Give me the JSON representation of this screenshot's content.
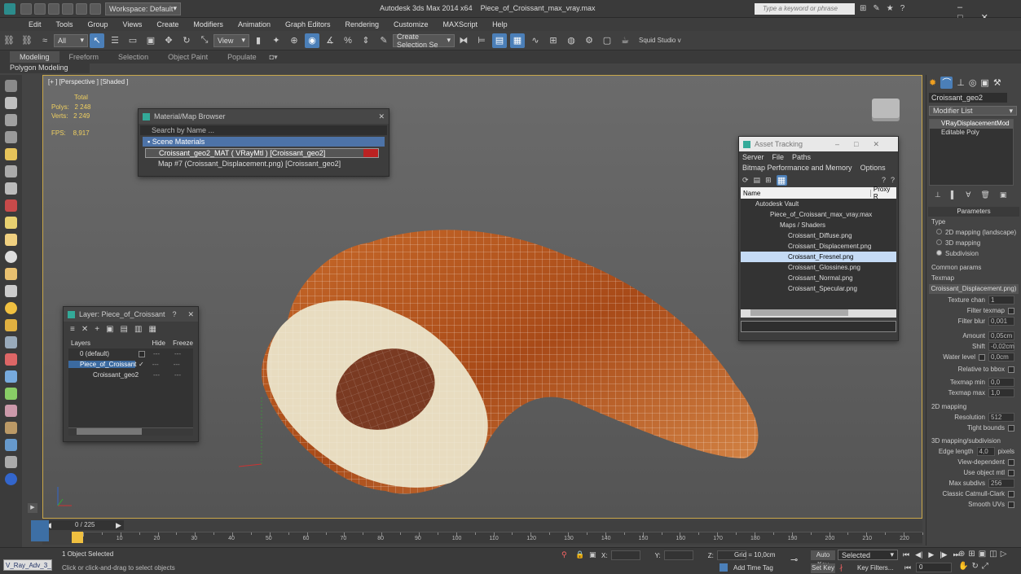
{
  "title": {
    "app": "Autodesk 3ds Max  2014 x64",
    "file": "Piece_of_Croissant_max_vray.max",
    "workspace": "Workspace: Default",
    "search_placeholder": "Type a keyword or phrase"
  },
  "menu": [
    "Edit",
    "Tools",
    "Group",
    "Views",
    "Create",
    "Modifiers",
    "Animation",
    "Graph Editors",
    "Rendering",
    "Customize",
    "MAXScript",
    "Help"
  ],
  "toolbar": {
    "filter": "All",
    "refcoord": "View",
    "selection_set": "Create Selection Se",
    "studio": "Squid Studio v"
  },
  "ribbon": {
    "tabs": [
      "Modeling",
      "Freeform",
      "Selection",
      "Object Paint",
      "Populate"
    ],
    "sub": "Polygon Modeling"
  },
  "viewport": {
    "label": "[+ ] [Perspective ] [Shaded ]",
    "stats_header": "Total",
    "polys_label": "Polys:",
    "polys": "2 248",
    "verts_label": "Verts:",
    "verts": "2 249",
    "fps_label": "FPS:",
    "fps": "8,917"
  },
  "material_browser": {
    "title": "Material/Map Browser",
    "search": "Search by Name ...",
    "group": "Scene Materials",
    "items": [
      "Croissant_geo2_MAT ( VRayMtl ) [Croissant_geo2]",
      "Map #7 (Croissant_Displacement.png) [Croissant_geo2]"
    ]
  },
  "layer_dialog": {
    "title": "Layer: Piece_of_Croissant",
    "cols": [
      "Layers",
      "Hide",
      "Freeze"
    ],
    "rows": [
      "0 (default)",
      "Piece_of_Croissant",
      "Croissant_geo2"
    ]
  },
  "asset_tracking": {
    "title": "Asset Tracking",
    "menu": [
      "Server",
      "File",
      "Paths"
    ],
    "menu2": [
      "Bitmap Performance and Memory",
      "Options"
    ],
    "cols": [
      "Name",
      "Proxy R"
    ],
    "rows": [
      "Autodesk Vault",
      "Piece_of_Croissant_max_vray.max",
      "Maps / Shaders",
      "Croissant_Diffuse.png",
      "Croissant_Displacement.png",
      "Croissant_Fresnel.png",
      "Croissant_Glossines.png",
      "Croissant_Normal.png",
      "Croissant_Specular.png"
    ]
  },
  "command_panel": {
    "object_name": "Croissant_geo2",
    "modifier_list": "Modifier List",
    "stack": [
      "VRayDisplacementMod",
      "Editable Poly"
    ],
    "params_title": "Parameters",
    "type_label": "Type",
    "types": [
      "2D mapping (landscape)",
      "3D mapping",
      "Subdivision"
    ],
    "common": "Common params",
    "texmap_label": "Texmap",
    "texmap": "Croissant_Displacement.png)",
    "texture_chan": {
      "label": "Texture chan",
      "value": "1"
    },
    "filter_texmap": "Filter texmap",
    "filter_blur": {
      "label": "Filter blur",
      "value": "0,001"
    },
    "amount": {
      "label": "Amount",
      "value": "0,05cm"
    },
    "shift": {
      "label": "Shift",
      "value": "-0,02cm"
    },
    "water": {
      "label": "Water level",
      "value": "0,0cm"
    },
    "relative": "Relative to bbox",
    "texmap_min": {
      "label": "Texmap min",
      "value": "0,0"
    },
    "texmap_max": {
      "label": "Texmap max",
      "value": "1,0"
    },
    "mapping2d": "2D mapping",
    "resolution": {
      "label": "Resolution",
      "value": "512"
    },
    "tight": "Tight bounds",
    "mapping3d": "3D mapping/subdivision",
    "edge": {
      "label": "Edge length",
      "value": "4,0",
      "unit": "pixels"
    },
    "view_dep": "View-dependent",
    "use_obj": "Use object mtl",
    "max_sub": {
      "label": "Max subdivs",
      "value": "256"
    },
    "catmull": "Classic Catmull-Clark",
    "smooth": "Smooth UVs"
  },
  "timeline": {
    "frame": "0 / 225",
    "ticks": [
      "10",
      "20",
      "30",
      "40",
      "50",
      "60",
      "70",
      "80",
      "90",
      "100",
      "110",
      "120",
      "130",
      "140",
      "150",
      "160",
      "170",
      "180",
      "190",
      "200",
      "210",
      "220"
    ]
  },
  "status": {
    "script": "V_Ray_Adv_3_",
    "selected": "1 Object Selected",
    "prompt": "Click or click-and-drag to select objects",
    "x": "X:",
    "y": "Y:",
    "z": "Z:",
    "grid": "Grid = 10,0cm",
    "autokey": "Auto Key",
    "selected_dd": "Selected",
    "setkey": "Set Key",
    "keyfilters": "Key Filters...",
    "addtime": "Add Time Tag",
    "frame": "0"
  }
}
